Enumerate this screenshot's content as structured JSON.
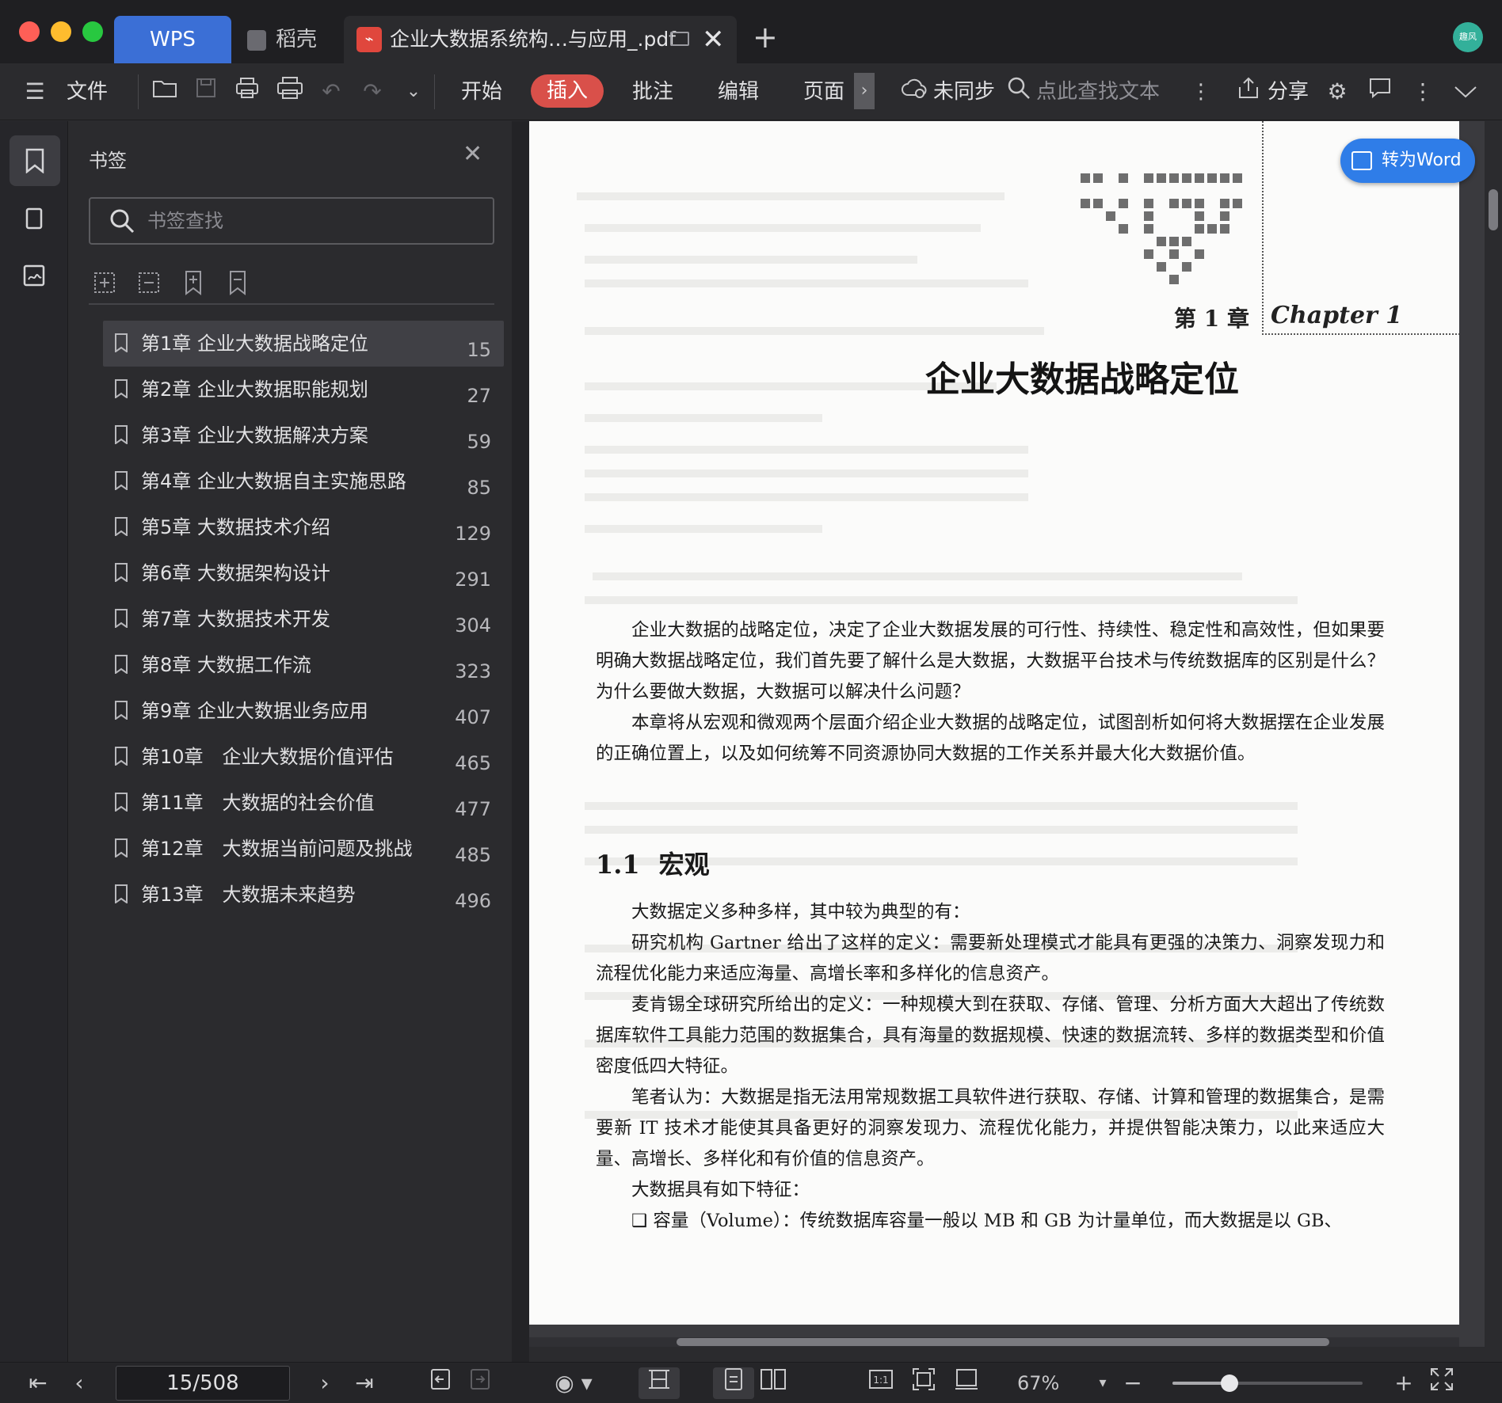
{
  "window": {
    "tabs": {
      "wps": "WPS",
      "daoke": "稻壳",
      "document": "企业大数据系统构…与应用_.pdf"
    },
    "avatar_text": "趣风"
  },
  "toolbar": {
    "file": "文件",
    "tabs": [
      "开始",
      "插入",
      "批注",
      "编辑",
      "页面"
    ],
    "active_tab": "插入",
    "sync_status": "未同步",
    "find_placeholder": "点此查找文本",
    "share": "分享"
  },
  "panel": {
    "title": "书签",
    "search_placeholder": "书签查找",
    "bookmarks": [
      {
        "label": "第1章 企业大数据战略定位",
        "page": "15",
        "active": true
      },
      {
        "label": "第2章 企业大数据职能规划",
        "page": "27"
      },
      {
        "label": "第3章 企业大数据解决方案",
        "page": "59"
      },
      {
        "label": "第4章 企业大数据自主实施思路",
        "page": "85"
      },
      {
        "label": "第5章 大数据技术介绍",
        "page": "129"
      },
      {
        "label": "第6章 大数据架构设计",
        "page": "291"
      },
      {
        "label": "第7章 大数据技术开发",
        "page": "304"
      },
      {
        "label": "第8章 大数据工作流",
        "page": "323"
      },
      {
        "label": "第9章 企业大数据业务应用",
        "page": "407"
      },
      {
        "label": "第10章　企业大数据价值评估",
        "page": "465"
      },
      {
        "label": "第11章　大数据的社会价值",
        "page": "477"
      },
      {
        "label": "第12章　大数据当前问题及挑战",
        "page": "485"
      },
      {
        "label": "第13章　大数据未来趋势",
        "page": "496"
      }
    ]
  },
  "document": {
    "chapter_number": "第 1 章",
    "chapter_script": "Chapter 1",
    "chapter_title": "企业大数据战略定位",
    "intro": [
      "企业大数据的战略定位，决定了企业大数据发展的可行性、持续性、稳定性和高效性，但如果要明确大数据战略定位，我们首先要了解什么是大数据，大数据平台技术与传统数据库的区别是什么？为什么要做大数据，大数据可以解决什么问题？",
      "本章将从宏观和微观两个层面介绍企业大数据的战略定位，试图剖析如何将大数据摆在企业发展的正确位置上，以及如何统筹不同资源协同大数据的工作关系并最大化大数据价值。"
    ],
    "section_number": "1.1",
    "section_title": "宏观",
    "body": [
      "大数据定义多种多样，其中较为典型的有：",
      "研究机构 Gartner 给出了这样的定义：需要新处理模式才能具有更强的决策力、洞察发现力和流程优化能力来适应海量、高增长率和多样化的信息资产。",
      "麦肯锡全球研究所给出的定义：一种规模大到在获取、存储、管理、分析方面大大超出了传统数据库软件工具能力范围的数据集合，具有海量的数据规模、快速的数据流转、多样的数据类型和价值密度低四大特征。",
      "笔者认为：大数据是指无法用常规数据工具软件进行获取、存储、计算和管理的数据集合，是需要新 IT 技术才能使其具备更好的洞察发现力、流程优化能力，并提供智能决策力，以此来适应大量、高增长、多样化和有价值的信息资产。",
      "大数据具有如下特征：",
      "❑ 容量（Volume）：传统数据库容量一般以 MB 和 GB 为计量单位，而大数据是以 GB、"
    ],
    "convert_button": "转为Word"
  },
  "statusbar": {
    "page_indicator": "15/508",
    "zoom": "67%",
    "zoom_level": 0.3
  }
}
